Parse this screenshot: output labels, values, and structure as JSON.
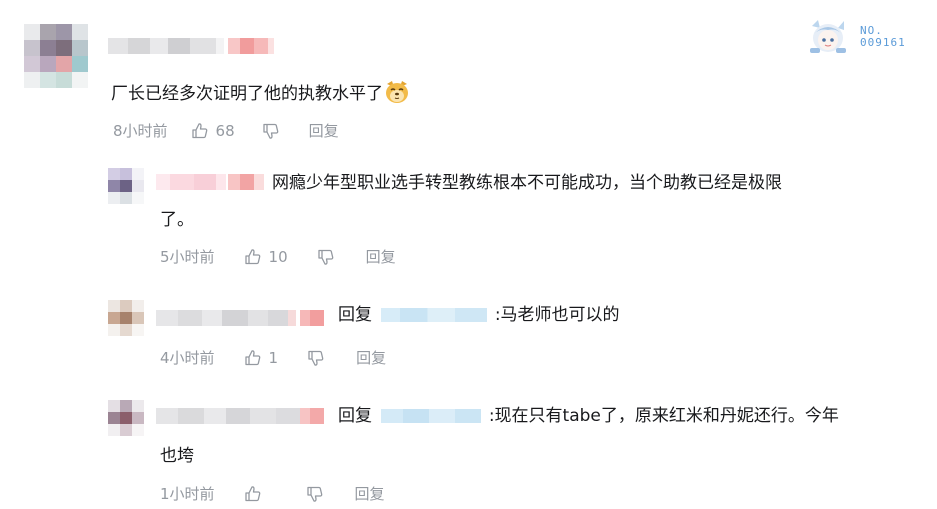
{
  "badge": {
    "label": "NO.",
    "number": "009161"
  },
  "comments": [
    {
      "text": "厂长已经多次证明了他的执教水平了",
      "emoji": "doge-emoji",
      "time": "8小时前",
      "likes": "68",
      "reply_label": "回复"
    }
  ],
  "replies": [
    {
      "text_line1": "网瘾少年型职业选手转型教练根本不可能成功，当个助教已经是极限",
      "text_line2": "了。",
      "time": "5小时前",
      "likes": "10",
      "reply_label": "回复"
    },
    {
      "reply_prefix": "回复",
      "text": ":马老师也可以的",
      "time": "4小时前",
      "likes": "1",
      "reply_label": "回复"
    },
    {
      "reply_prefix": "回复",
      "text_line1": ":现在只有tabe了，原来红米和丹妮还行。今年",
      "text_line2": "也垮",
      "time": "1小时前",
      "likes": "",
      "reply_label": "回复"
    }
  ],
  "colors": {
    "text": "#18191c",
    "meta": "#9499a0",
    "badge": "#5b9bd8",
    "mention_blur": "#d2e9f6",
    "name_pink": "#f4a7a7"
  }
}
